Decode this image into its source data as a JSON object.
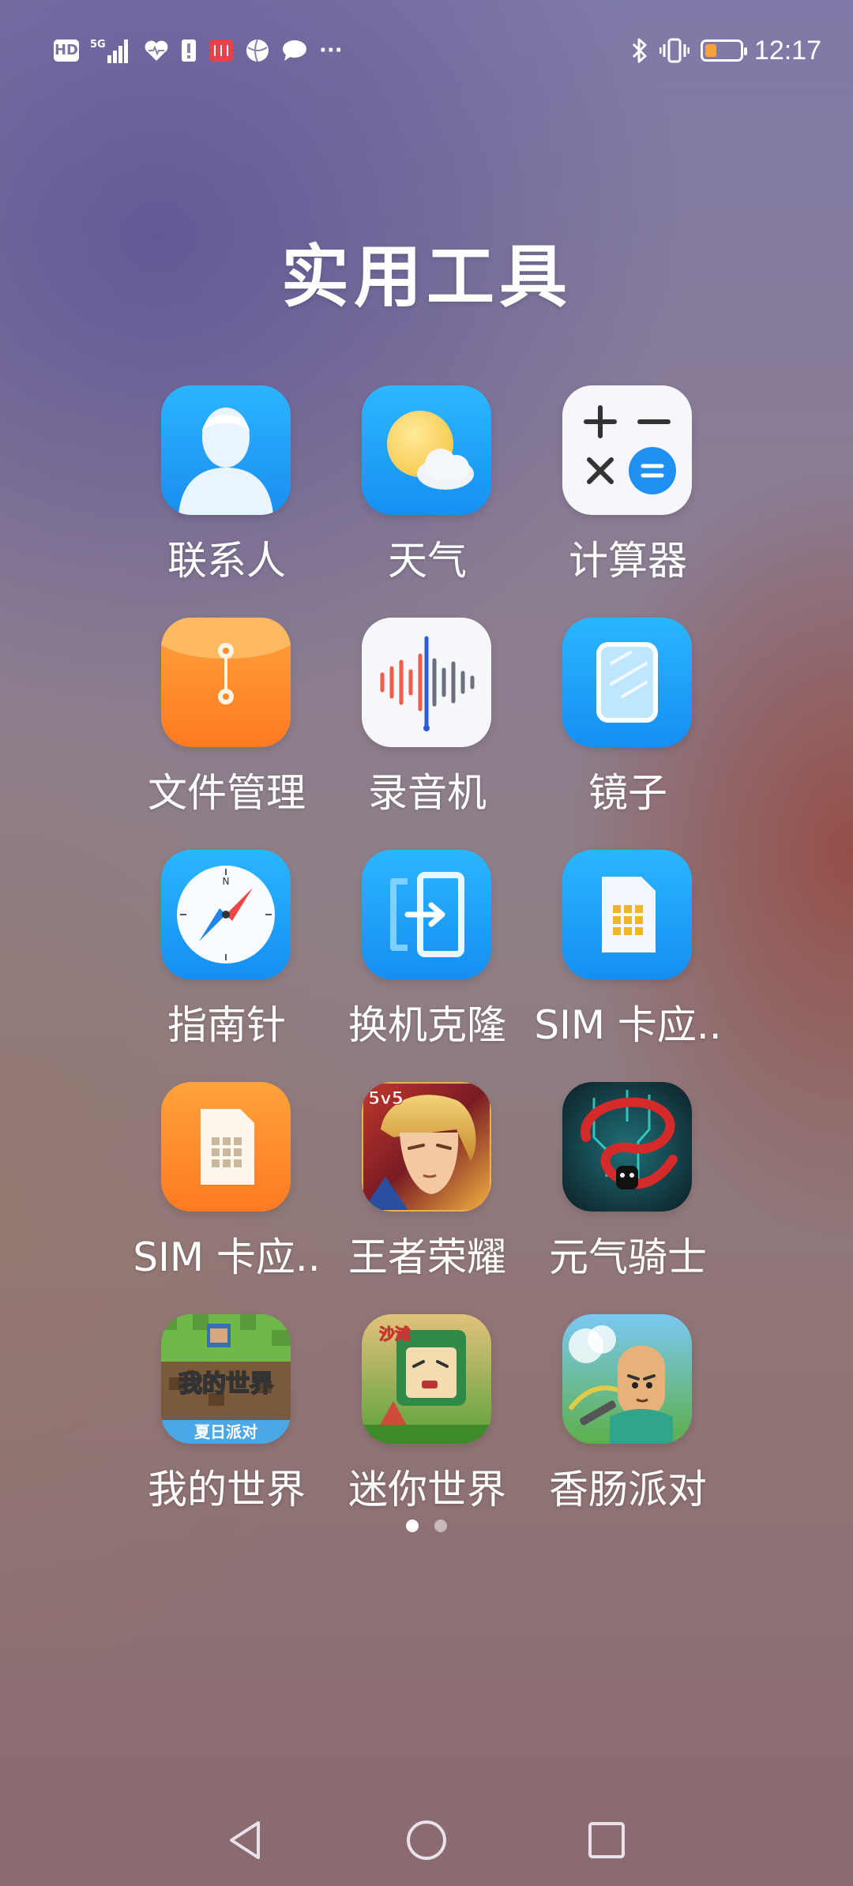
{
  "status_bar": {
    "time": "12:17",
    "left_icons": [
      "hd-icon",
      "signal-5g-icon",
      "health-icon",
      "sim-alert-icon",
      "book-icon",
      "browser-icon",
      "chat-icon",
      "more-icon"
    ],
    "hd_label": "HD",
    "net_label": "5G",
    "more_label": "···",
    "right_icons": [
      "bluetooth-icon",
      "vibrate-icon",
      "battery-icon"
    ],
    "battery_level_percent": 20
  },
  "folder": {
    "title": "实用工具"
  },
  "apps": [
    {
      "label": "联系人",
      "icon": "contacts-icon"
    },
    {
      "label": "天气",
      "icon": "weather-icon"
    },
    {
      "label": "计算器",
      "icon": "calculator-icon"
    },
    {
      "label": "文件管理",
      "icon": "files-icon"
    },
    {
      "label": "录音机",
      "icon": "recorder-icon"
    },
    {
      "label": "镜子",
      "icon": "mirror-icon"
    },
    {
      "label": "指南针",
      "icon": "compass-icon"
    },
    {
      "label": "换机克隆",
      "icon": "phone-clone-icon"
    },
    {
      "label": "SIM 卡应..",
      "icon": "sim-app-icon"
    },
    {
      "label": "SIM 卡应..",
      "icon": "sim-app-orange-icon"
    },
    {
      "label": "王者荣耀",
      "icon": "honor-of-kings-icon",
      "badge": "5v5"
    },
    {
      "label": "元气骑士",
      "icon": "soul-knight-icon"
    },
    {
      "label": "我的世界",
      "icon": "minecraft-icon",
      "sub": "我的世界",
      "ribbon": "夏日派对"
    },
    {
      "label": "迷你世界",
      "icon": "mini-world-icon",
      "badge": "沙滩"
    },
    {
      "label": "香肠派对",
      "icon": "sausage-man-icon"
    }
  ],
  "page_indicator": {
    "pages": 2,
    "current": 1
  },
  "nav": {
    "back": "back-icon",
    "home": "home-icon",
    "recents": "recents-icon"
  },
  "colors": {
    "blue_icon": "#1ea7f7",
    "orange_icon": "#ff8a2a",
    "battery": "#f4a23a"
  }
}
